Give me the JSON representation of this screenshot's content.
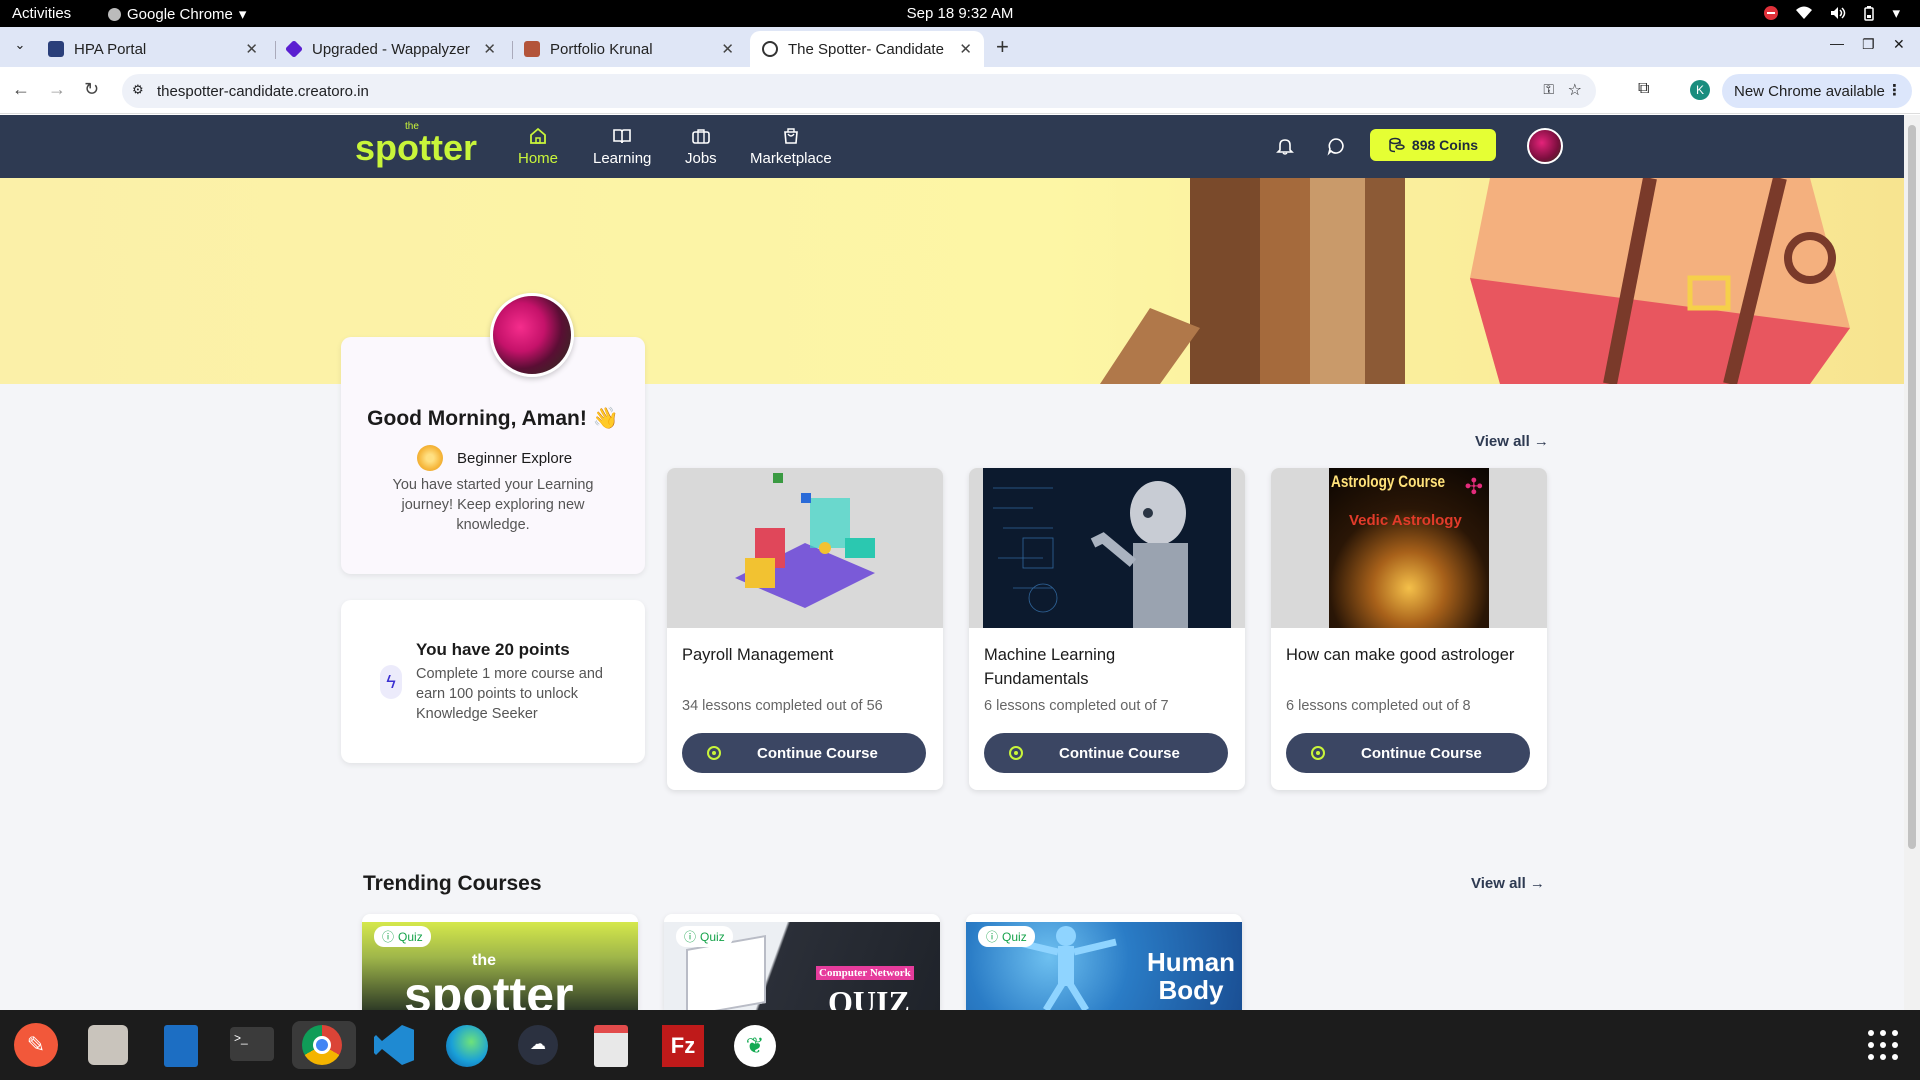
{
  "system": {
    "activities": "Activities",
    "app_name": "Google Chrome",
    "clock": "Sep 18  9:32 AM"
  },
  "browser": {
    "tabs": [
      {
        "title": "HPA Portal",
        "favicon_color": "#2a3f7a"
      },
      {
        "title": "Upgraded - Wappalyzer",
        "favicon_color": "#5a1fd1"
      },
      {
        "title": "Portfolio Krunal",
        "favicon_color": "#b3543a"
      },
      {
        "title": "The Spotter- Candidate F",
        "favicon_color": "#333333"
      }
    ],
    "url": "thespotter-candidate.creatoro.in",
    "profile_initial": "K",
    "new_chrome": "New Chrome available"
  },
  "site": {
    "logo": "spotter",
    "logo_small": "the",
    "nav": [
      {
        "label": "Home",
        "icon": "home-icon"
      },
      {
        "label": "Learning",
        "icon": "book-icon"
      },
      {
        "label": "Jobs",
        "icon": "briefcase-icon"
      },
      {
        "label": "Marketplace",
        "icon": "shopping-bag-icon"
      }
    ],
    "coins": "898 Coins"
  },
  "greeting": {
    "title": "Good Morning, Aman! 👋",
    "level": "Beginner Explore",
    "message": "You have started your Learning journey! Keep exploring new knowledge."
  },
  "points": {
    "title": "You have 20 points",
    "message": "Complete 1 more course and earn 100 points to unlock Knowledge Seeker"
  },
  "continue_section": {
    "view_all": "View all →",
    "courses": [
      {
        "title": "Payroll Management",
        "progress": "34 lessons completed out of 56",
        "button": "Continue Course"
      },
      {
        "title": "Machine Learning Fundamentals",
        "progress": "6 lessons completed out of 7",
        "button": "Continue Course"
      },
      {
        "title": "How can make good astrologer",
        "progress": "6 lessons completed out of 8",
        "button": "Continue Course",
        "image_title": "Astrology Course",
        "image_subtitle": "Vedic Astrology"
      }
    ]
  },
  "trending": {
    "title": "Trending Courses",
    "view_all": "View all →",
    "cards": [
      {
        "tag": "Quiz",
        "image_text": "spotter",
        "image_small": "the"
      },
      {
        "tag": "Quiz",
        "image_text": "QUIZ",
        "image_small": "Computer Network"
      },
      {
        "tag": "Quiz",
        "image_text": "Human Body"
      }
    ]
  },
  "colors": {
    "nav_bg": "#2e3a52",
    "accent": "#c9f53a",
    "coins_bg": "#e5ff34",
    "button_bg": "#3b4663"
  }
}
